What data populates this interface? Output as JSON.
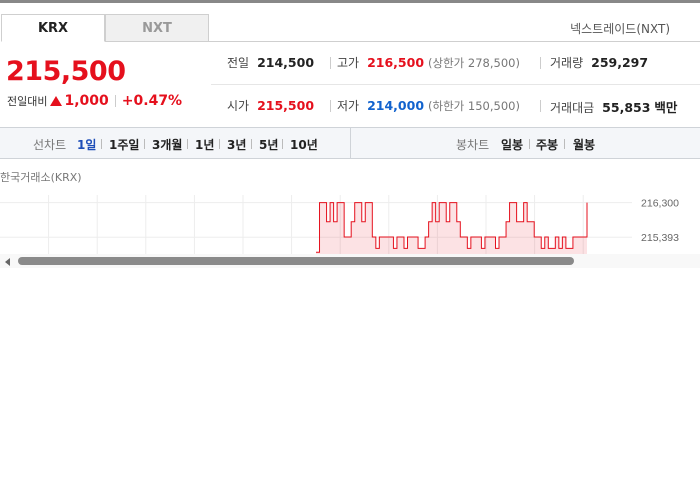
{
  "tabs": [
    {
      "label": "KRX",
      "active": true
    },
    {
      "label": "NXT",
      "active": false
    }
  ],
  "nxt_link": "넥스트레이드(NXT)",
  "quote": {
    "price": "215,500",
    "change_label": "전일대비",
    "change_amount": "1,000",
    "change_percent": "+0.47%",
    "direction": "up"
  },
  "stats": {
    "prev_close": {
      "label": "전일",
      "value": "214,500"
    },
    "high": {
      "label": "고가",
      "value": "216,500",
      "sub": "(상한가 278,500)"
    },
    "volume": {
      "label": "거래량",
      "value": "259,297"
    },
    "open": {
      "label": "시가",
      "value": "215,500"
    },
    "low": {
      "label": "저가",
      "value": "214,000",
      "sub": "(하한가 150,500)"
    },
    "turnover": {
      "label": "거래대금",
      "value": "55,853",
      "unit": "백만"
    }
  },
  "toolbar": {
    "line_chart_label": "선차트",
    "line_periods": [
      "1일",
      "1주일",
      "3개월",
      "1년",
      "3년",
      "5년",
      "10년"
    ],
    "active_period": "1일",
    "candle_chart_label": "봉차트",
    "candle_periods": [
      "일봉",
      "주봉",
      "월봉"
    ]
  },
  "chart_data": {
    "type": "line",
    "title": "한국거래소(KRX)",
    "y_tick_labels": [
      "216,300",
      "215,393"
    ],
    "ylim": [
      214900,
      216500
    ],
    "grid": true,
    "color": "#e5101d",
    "values": [
      215000,
      216300,
      216300,
      215800,
      216300,
      215800,
      216300,
      216300,
      215400,
      215400,
      215800,
      216300,
      216300,
      215800,
      216300,
      216300,
      215400,
      215100,
      215400,
      215400,
      215400,
      215400,
      215100,
      215400,
      215400,
      215100,
      215400,
      215400,
      215400,
      215100,
      215100,
      215400,
      215800,
      216300,
      215800,
      216300,
      216300,
      215800,
      216300,
      216300,
      215800,
      215400,
      215400,
      215100,
      215400,
      215400,
      215400,
      215100,
      215400,
      215400,
      215400,
      215100,
      215400,
      215400,
      215800,
      216300,
      216300,
      215800,
      215800,
      216300,
      215800,
      215800,
      215400,
      215400,
      215100,
      215400,
      215100,
      215100,
      215400,
      215100,
      215400,
      215100,
      215100,
      215400,
      215400,
      215400,
      215400,
      216300
    ]
  }
}
